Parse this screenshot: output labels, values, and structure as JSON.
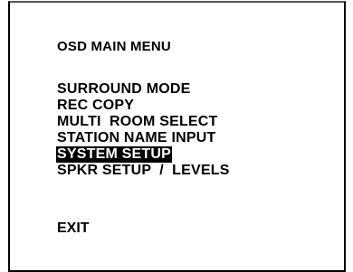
{
  "screen": {
    "title": "OSD MAIN MENU",
    "menu_items": [
      {
        "label": "SURROUND MODE",
        "selected": false
      },
      {
        "label": "REC COPY",
        "selected": false
      },
      {
        "label": "MULTI  ROOM SELECT",
        "selected": false
      },
      {
        "label": "STATION NAME INPUT",
        "selected": false
      },
      {
        "label": "SYSTEM SETUP",
        "selected": true
      },
      {
        "label": "SPKR SETUP  /  LEVELS",
        "selected": false
      }
    ],
    "exit_label": "EXIT"
  },
  "colors": {
    "background": "#ffffff",
    "text": "#000000",
    "highlight_background": "#000000",
    "highlight_text": "#ffffff"
  }
}
